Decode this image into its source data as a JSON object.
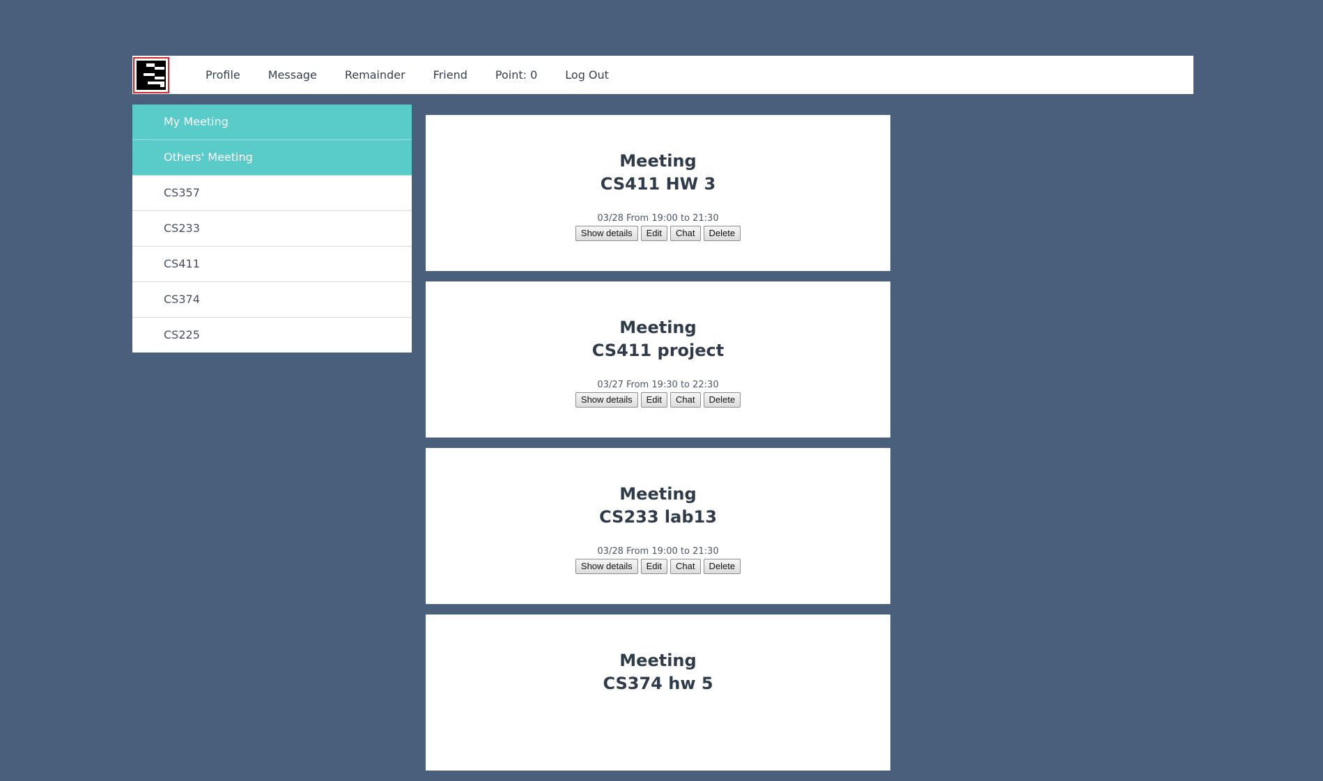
{
  "nav": {
    "items": [
      "Profile",
      "Message",
      "Remainder",
      "Friend",
      "Point: 0",
      "Log Out"
    ]
  },
  "sidebar": {
    "items": [
      {
        "label": "My Meeting",
        "active": true
      },
      {
        "label": "Others' Meeting",
        "active": true
      },
      {
        "label": "CS357",
        "active": false
      },
      {
        "label": "CS233",
        "active": false
      },
      {
        "label": "CS411",
        "active": false
      },
      {
        "label": "CS374",
        "active": false
      },
      {
        "label": "CS225",
        "active": false
      }
    ]
  },
  "meetings": [
    {
      "label": "Meeting",
      "title": "CS411 HW 3",
      "time": "03/28 From 19:00 to 21:30",
      "buttons": [
        "Show details",
        "Edit",
        "Chat",
        "Delete"
      ]
    },
    {
      "label": "Meeting",
      "title": "CS411 project",
      "time": "03/27 From 19:30 to 22:30",
      "buttons": [
        "Show details",
        "Edit",
        "Chat",
        "Delete"
      ]
    },
    {
      "label": "Meeting",
      "title": "CS233 lab13",
      "time": "03/28 From 19:00 to 21:30",
      "buttons": [
        "Show details",
        "Edit",
        "Chat",
        "Delete"
      ]
    },
    {
      "label": "Meeting",
      "title": "CS374 hw 5",
      "time": "",
      "buttons": []
    }
  ],
  "colors": {
    "background": "#4a5f7b",
    "accent": "#59cbc9",
    "logo_border": "#d9262e"
  }
}
